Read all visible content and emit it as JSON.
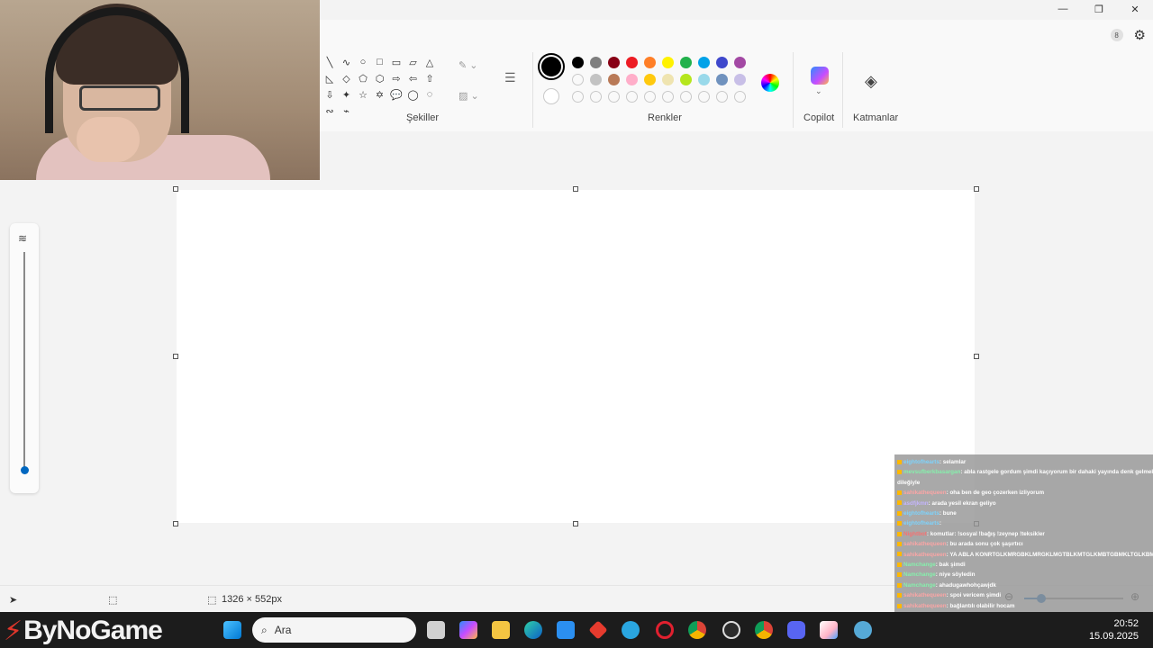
{
  "window": {
    "minimize": "—",
    "restore": "❐",
    "close": "✕"
  },
  "ribbon": {
    "badge": "8",
    "settings_icon": "gear-icon",
    "shapes_label": "Şekiller",
    "colors_label": "Renkler",
    "copilot_label": "Copilot",
    "layers_label": "Katmanlar",
    "shapes": [
      "╲",
      "∿",
      "○",
      "□",
      "▭",
      "▱",
      "△",
      "◺",
      "◇",
      "⬠",
      "⬡",
      "⇨",
      "⇦",
      "⇧",
      "⇩",
      "✦",
      "☆",
      "✡",
      "💬",
      "◯",
      "◌",
      "∾",
      "⌁"
    ],
    "palette_row1": [
      "#000000",
      "#7f7f7f",
      "#880015",
      "#ed1c24",
      "#ff7f27",
      "#fff200",
      "#22b14c",
      "#00a2e8",
      "#3f48cc",
      "#a349a4"
    ],
    "palette_row2": [
      "empty",
      "#c3c3c3",
      "#b97a57",
      "#ffaec9",
      "#ffc90e",
      "#efe4b0",
      "#b5e61d",
      "#99d9ea",
      "#7092be",
      "#c8bfe7"
    ]
  },
  "statusbar": {
    "canvas_size": "1326 × 552px"
  },
  "chat": [
    {
      "user": "eightofhearts",
      "text": ": selamlar",
      "color": "#7dd3fc"
    },
    {
      "user": "mevsufberkbasargan",
      "text": ": abla rastgele gordum şimdi kaçıyorum bir dahaki yayında denk gelmek",
      "color": "#86efac"
    },
    {
      "user": "",
      "text": "dileğiyle",
      "color": "#fff"
    },
    {
      "user": "sahikathequeen",
      "text": ": oha ben de geo çozerken izliyorum",
      "color": "#fca5a5"
    },
    {
      "user": "asdfjkmn",
      "text": ": arada yesil ekran geliyo",
      "color": "#c4b5fd"
    },
    {
      "user": "eightofhearts",
      "text": ": bune",
      "color": "#7dd3fc"
    },
    {
      "user": "eightofhearts",
      "text": ":",
      "color": "#7dd3fc"
    },
    {
      "user": "Nightbot",
      "text": ": komutlar: !sosyal !bağış !zeynep !teksikler",
      "color": "#f87171"
    },
    {
      "user": "sahikathequeen",
      "text": ": bu arada sonu çok şaşırtıcı",
      "color": "#fca5a5"
    },
    {
      "user": "sahikathequeen",
      "text": ": YA ABLA KONRTGLKMRGBKLMRGKLMGTBLKMTGLKMBTGBMKLTGLKBM",
      "color": "#fca5a5"
    },
    {
      "user": "Namchange",
      "text": ": bak şimdi",
      "color": "#86efac"
    },
    {
      "user": "Namchange",
      "text": ": niye söyledin",
      "color": "#86efac"
    },
    {
      "user": "Namchange",
      "text": ": ahadugawhohçawjdk",
      "color": "#86efac"
    },
    {
      "user": "sahikathequeen",
      "text": ": spoi vericem şimdi",
      "color": "#fca5a5"
    },
    {
      "user": "sahikathequeen",
      "text": ": bağlantılı olabilir hocam",
      "color": "#fca5a5"
    },
    {
      "user": "asdfjkmn",
      "text": ": kanka plaka 06 diye ankarada mi olcak mal BZJSJXUXISNXHISKSHX",
      "color": "#c4b5fd"
    },
    {
      "user": "sahikathequeen",
      "text": ": hemen sonra olmuyor ya bu aralar çocuğu arıyorlar",
      "color": "#fca5a5"
    },
    {
      "user": "sahikathequeen",
      "text": ": abla illa bana spoi verdircen ya",
      "color": "#fca5a5"
    }
  ],
  "taskbar": {
    "logo_text": "ByNoGame",
    "logo_badge": "3",
    "search_placeholder": "Ara",
    "time": "20:52",
    "date": "15.09.2025"
  }
}
